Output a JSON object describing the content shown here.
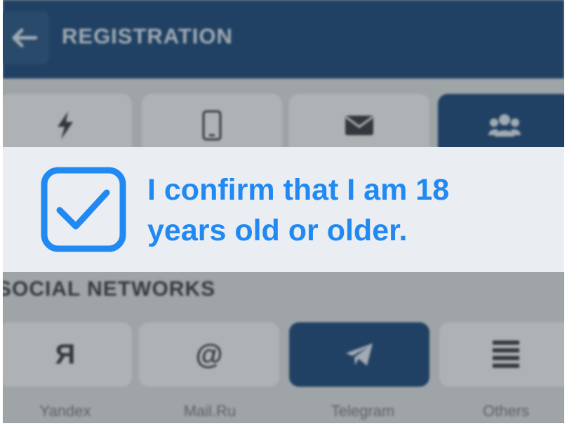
{
  "colors": {
    "header_bg": "#123e6b",
    "accent": "#2189f2",
    "banner_bg": "#eaedf1"
  },
  "header": {
    "title": "REGISTRATION",
    "back_icon": "arrow-left-icon"
  },
  "registration_tabs": [
    {
      "icon": "lightning-icon",
      "active": false
    },
    {
      "icon": "smartphone-icon",
      "active": false
    },
    {
      "icon": "envelope-icon",
      "active": false
    },
    {
      "icon": "users-icon",
      "active": true
    }
  ],
  "confirm": {
    "checked": true,
    "text": "I confirm that I am 18 years old or older."
  },
  "social": {
    "title": "SOCIAL NETWORKS",
    "items": [
      {
        "glyph": "Я",
        "label": "Yandex",
        "icon": "yandex-icon",
        "active": false
      },
      {
        "glyph": "@",
        "label": "Mail.Ru",
        "icon": "at-sign-icon",
        "active": false
      },
      {
        "glyph": "",
        "label": "Telegram",
        "icon": "telegram-icon",
        "active": true
      },
      {
        "glyph": "",
        "label": "Others",
        "icon": "menu-lines-icon",
        "active": false
      }
    ]
  }
}
